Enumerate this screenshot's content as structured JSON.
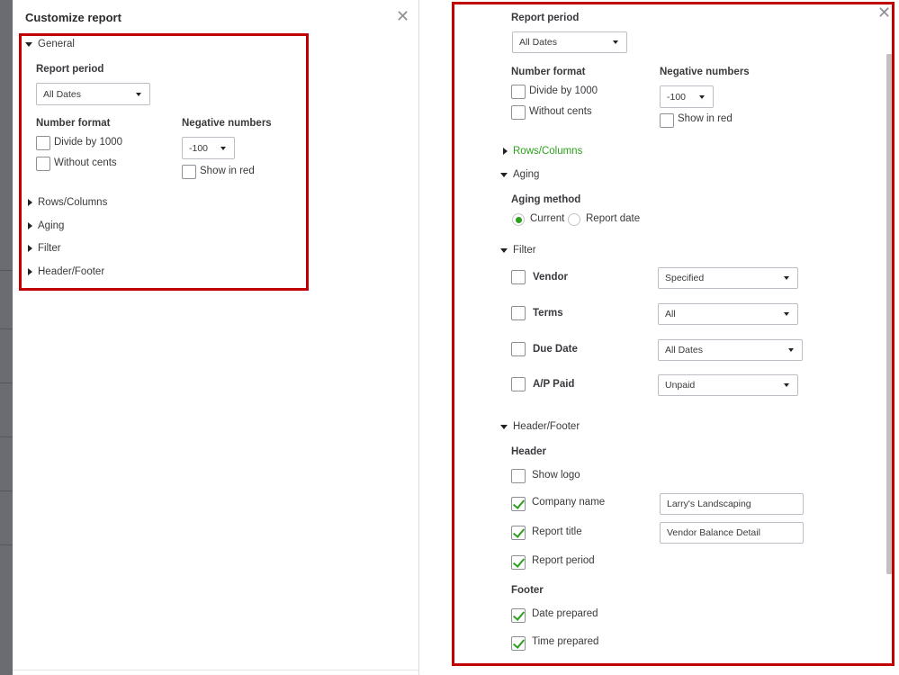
{
  "left": {
    "title": "Customize report",
    "close_icon": "close-icon",
    "sections": {
      "general": "General",
      "rows_columns": "Rows/Columns",
      "aging": "Aging",
      "filter": "Filter",
      "header_footer": "Header/Footer"
    },
    "report_period_label": "Report period",
    "report_period_value": "All Dates",
    "number_format_label": "Number format",
    "divide_by_1000": "Divide by 1000",
    "without_cents": "Without cents",
    "negative_numbers_label": "Negative numbers",
    "negative_numbers_value": "-100",
    "show_in_red": "Show in red"
  },
  "right": {
    "close_icon": "close-icon",
    "report_period_label": "Report period",
    "report_period_value": "All Dates",
    "number_format_label": "Number format",
    "divide_by_1000": "Divide by 1000",
    "without_cents": "Without cents",
    "negative_numbers_label": "Negative numbers",
    "negative_numbers_value": "-100",
    "show_in_red": "Show in red",
    "sections": {
      "rows_columns": "Rows/Columns",
      "aging": "Aging",
      "filter": "Filter",
      "header_footer": "Header/Footer"
    },
    "aging_method_label": "Aging method",
    "aging_options": [
      "Current",
      "Report date"
    ],
    "filters": [
      {
        "label": "Vendor",
        "value": "Specified",
        "checked": false
      },
      {
        "label": "Terms",
        "value": "All",
        "checked": false
      },
      {
        "label": "Due Date",
        "value": "All Dates",
        "checked": false
      },
      {
        "label": "A/P Paid",
        "value": "Unpaid",
        "checked": false
      }
    ],
    "header_label": "Header",
    "show_logo": "Show logo",
    "company_name": "Company name",
    "company_name_value": "Larry's Landscaping",
    "report_title": "Report title",
    "report_title_value": "Vendor Balance Detail",
    "report_period": "Report period",
    "footer_label": "Footer",
    "date_prepared": "Date prepared",
    "time_prepared": "Time prepared"
  },
  "colors": {
    "highlight": "#c00000",
    "accent_green": "#2ca01c"
  }
}
